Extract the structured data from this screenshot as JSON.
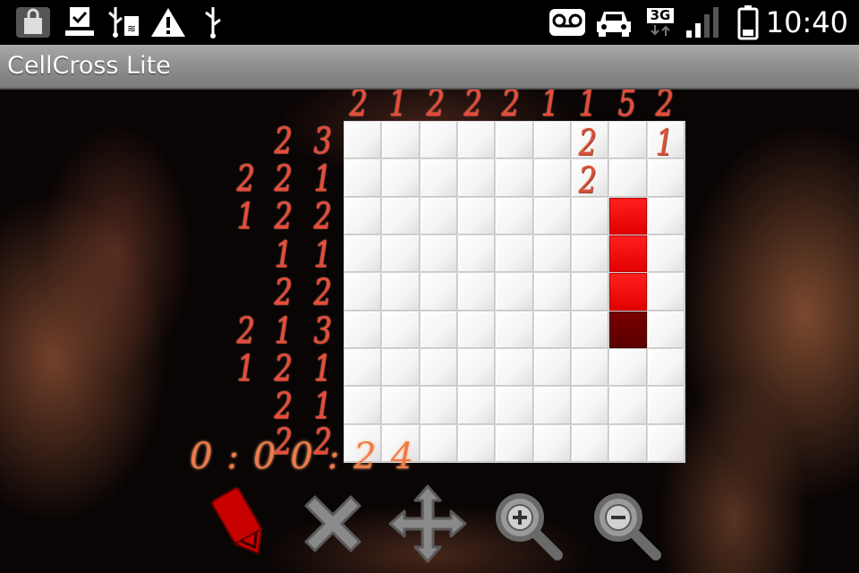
{
  "status_bar": {
    "icons": [
      "shopping-bag-icon",
      "download-complete-icon",
      "usb-sd-icon",
      "warning-icon",
      "usb-icon",
      "voicemail-icon",
      "car-icon",
      "3g-signal-icon",
      "signal-bars-icon",
      "battery-icon"
    ],
    "network_label": "3G",
    "time": "10:40"
  },
  "app": {
    "title": "CellCross Lite"
  },
  "puzzle": {
    "rows": 9,
    "cols": 9,
    "column_clues": [
      "2",
      "1",
      "2",
      "2",
      "2",
      "1",
      "1",
      "5",
      "2"
    ],
    "column_clues_in_grid": {
      "col7": [
        "2",
        "2"
      ],
      "col9": [
        "1"
      ]
    },
    "row_clues": [
      [
        "2",
        "3"
      ],
      [
        "2",
        "2",
        "1"
      ],
      [
        "1",
        "2",
        "2"
      ],
      [
        "1",
        "1"
      ],
      [
        "2",
        "2"
      ],
      [
        "2",
        "1",
        "3"
      ],
      [
        "1",
        "2",
        "1"
      ],
      [
        "2",
        "1"
      ],
      [
        "2",
        "2"
      ]
    ],
    "filled_cells": [
      [
        2,
        7
      ],
      [
        3,
        7
      ],
      [
        4,
        7
      ]
    ],
    "cursor_cell": [
      5,
      7
    ],
    "accent_color": "#ff1010",
    "cursor_color": "#6a0000"
  },
  "timer": {
    "value": "0:00:24"
  },
  "toolbar": {
    "tools": [
      "pencil-icon",
      "cross-icon",
      "move-icon",
      "zoom-in-icon",
      "zoom-out-icon"
    ],
    "active_tool": "pencil-icon"
  }
}
